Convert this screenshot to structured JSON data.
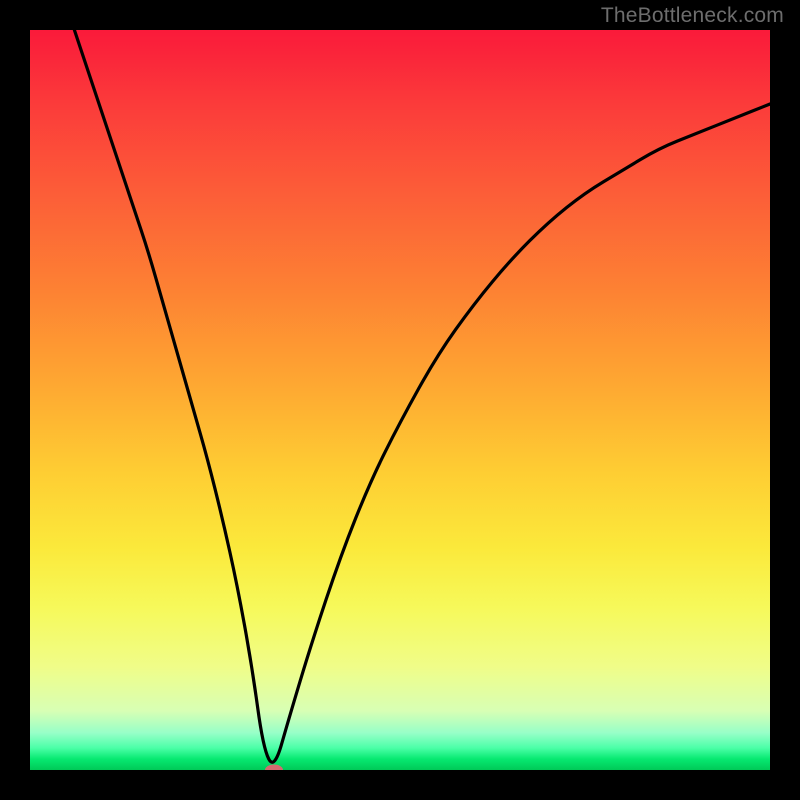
{
  "watermark": "TheBottleneck.com",
  "chart_data": {
    "type": "line",
    "title": "",
    "xlabel": "",
    "ylabel": "",
    "xlim": [
      0,
      100
    ],
    "ylim": [
      0,
      100
    ],
    "background_gradient_stops": [
      {
        "pos": 0,
        "color": "#fa1a3a"
      },
      {
        "pos": 50,
        "color": "#fea431"
      },
      {
        "pos": 80,
        "color": "#f4fd77"
      },
      {
        "pos": 100,
        "color": "#00c957"
      }
    ],
    "series": [
      {
        "name": "bottleneck-curve",
        "color": "#000000",
        "x": [
          6,
          8,
          10,
          12,
          14,
          16,
          18,
          20,
          22,
          24,
          26,
          28,
          30,
          31.5,
          33,
          35,
          38,
          42,
          46,
          50,
          55,
          60,
          65,
          70,
          75,
          80,
          85,
          90,
          95,
          100
        ],
        "values": [
          100,
          94,
          88,
          82,
          76,
          70,
          63,
          56,
          49,
          42,
          34,
          25,
          14,
          3,
          0,
          7,
          17,
          29,
          39,
          47,
          56,
          63,
          69,
          74,
          78,
          81,
          84,
          86,
          88,
          90
        ]
      }
    ],
    "marker": {
      "x": 33,
      "y": 0,
      "color": "#d46a6f"
    }
  }
}
